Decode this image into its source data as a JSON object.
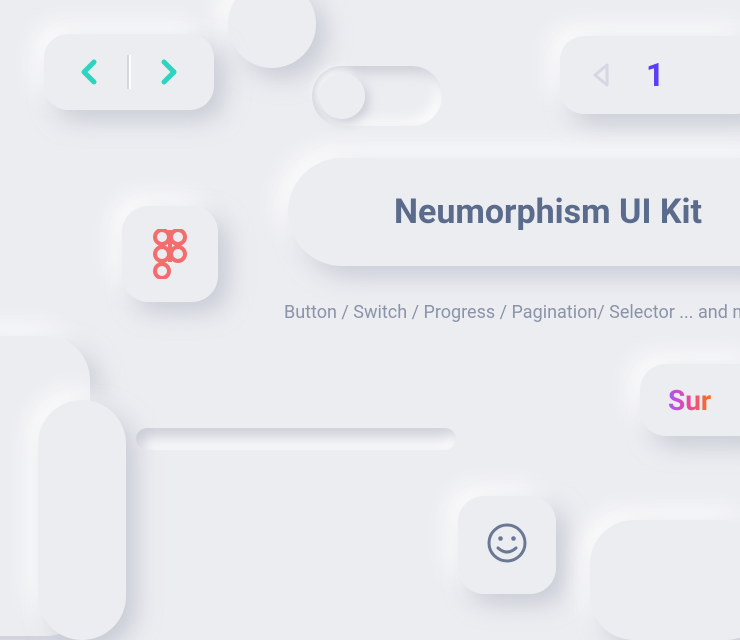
{
  "title": "Neumorphism UI Kit",
  "subtitle": "Button / Switch / Progress / Pagination/ Selector ... and mo",
  "pagination": {
    "current": "1"
  },
  "sun_button": {
    "label": "Sur"
  },
  "icons": {
    "chevron_left": "chevron-left-icon",
    "chevron_right": "chevron-right-icon",
    "triangle_left": "triangle-left-icon",
    "figma": "figma-icon",
    "smiley": "smiley-icon"
  },
  "colors": {
    "accent_teal": "#2dd4bf",
    "accent_indigo": "#5b3df5",
    "text_muted": "#5a6b8c",
    "icon_red": "#f26d6d"
  }
}
